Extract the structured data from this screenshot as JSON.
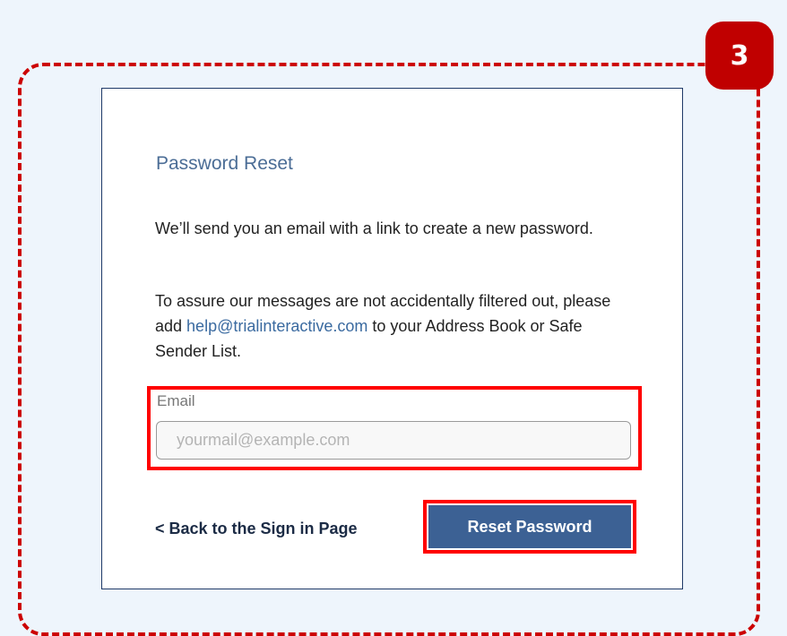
{
  "annotation": {
    "step_number": "3"
  },
  "card": {
    "title": "Password Reset",
    "para1": "We’ll send you an email with a link to create a new password.",
    "para2_before": "To assure our messages are not accidentally filtered out, please add ",
    "para2_email": "help@trialinteractive.com",
    "para2_after": " to your Address Book or Safe Sender List.",
    "email_label": "Email",
    "email_value": "",
    "email_placeholder": "yourmail@example.com",
    "back_link": "< Back to the Sign in Page",
    "reset_button": "Reset Password"
  },
  "colors": {
    "highlight": "#ff0000",
    "badge": "#c00000",
    "button": "#3c6194",
    "title": "#4b6d96"
  }
}
